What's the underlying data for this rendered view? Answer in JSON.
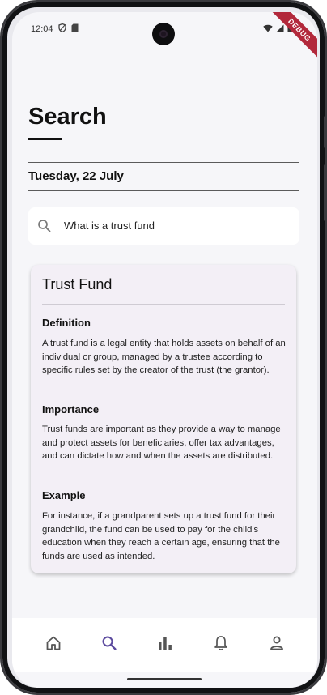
{
  "status_bar": {
    "time": "12:04",
    "debug_label": "DEBUG"
  },
  "header": {
    "title": "Search",
    "date": "Tuesday, 22 July"
  },
  "search": {
    "value": "What is a trust fund"
  },
  "result_card": {
    "title": "Trust Fund",
    "sections": [
      {
        "heading": "Definition",
        "body": "A trust fund is a legal entity that holds assets on behalf of an individual or group, managed by a trustee according to specific rules set by the creator of the trust (the grantor)."
      },
      {
        "heading": "Importance",
        "body": "Trust funds are important as they provide a way to manage and protect assets for beneficiaries, offer tax advantages, and can dictate how and when the assets are distributed."
      },
      {
        "heading": "Example",
        "body": "For instance, if a grandparent sets up a trust fund for their grandchild, the fund can be used to pay for the child's education when they reach a certain age, ensuring that the funds are used as intended."
      }
    ]
  },
  "bottom_nav": {
    "items": [
      {
        "icon": "home-icon",
        "active": false
      },
      {
        "icon": "search-icon",
        "active": true
      },
      {
        "icon": "bar-chart-icon",
        "active": false
      },
      {
        "icon": "bell-icon",
        "active": false
      },
      {
        "icon": "person-icon",
        "active": false
      }
    ],
    "active_color": "#5b4a9e",
    "inactive_color": "#555555"
  }
}
